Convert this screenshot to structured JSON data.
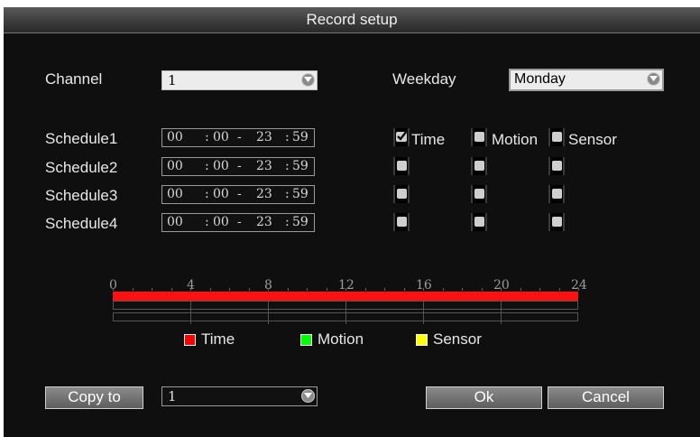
{
  "window": {
    "title": "Record setup"
  },
  "channel": {
    "label": "Channel",
    "value": "1"
  },
  "weekday": {
    "label": "Weekday",
    "value": "Monday"
  },
  "schedules": [
    {
      "label": "Schedule1",
      "start_h": "00",
      "start_m": "00",
      "end_h": "23",
      "end_m": "59",
      "time": true,
      "motion": false,
      "sensor": false
    },
    {
      "label": "Schedule2",
      "start_h": "00",
      "start_m": "00",
      "end_h": "23",
      "end_m": "59",
      "time": false,
      "motion": false,
      "sensor": false
    },
    {
      "label": "Schedule3",
      "start_h": "00",
      "start_m": "00",
      "end_h": "23",
      "end_m": "59",
      "time": false,
      "motion": false,
      "sensor": false
    },
    {
      "label": "Schedule4",
      "start_h": "00",
      "start_m": "00",
      "end_h": "23",
      "end_m": "59",
      "time": false,
      "motion": false,
      "sensor": false
    }
  ],
  "types": {
    "time": "Time",
    "motion": "Motion",
    "sensor": "Sensor"
  },
  "timeline": {
    "hours": [
      "0",
      "4",
      "8",
      "12",
      "16",
      "20",
      "24"
    ],
    "time_recording": [
      [
        0,
        24
      ]
    ]
  },
  "legend": [
    {
      "label": "Time",
      "color": "#ff0000"
    },
    {
      "label": "Motion",
      "color": "#00ff00"
    },
    {
      "label": "Sensor",
      "color": "#ffff00"
    }
  ],
  "copy": {
    "button_label": "Copy to",
    "target": "1"
  },
  "buttons": {
    "ok": "Ok",
    "cancel": "Cancel"
  }
}
